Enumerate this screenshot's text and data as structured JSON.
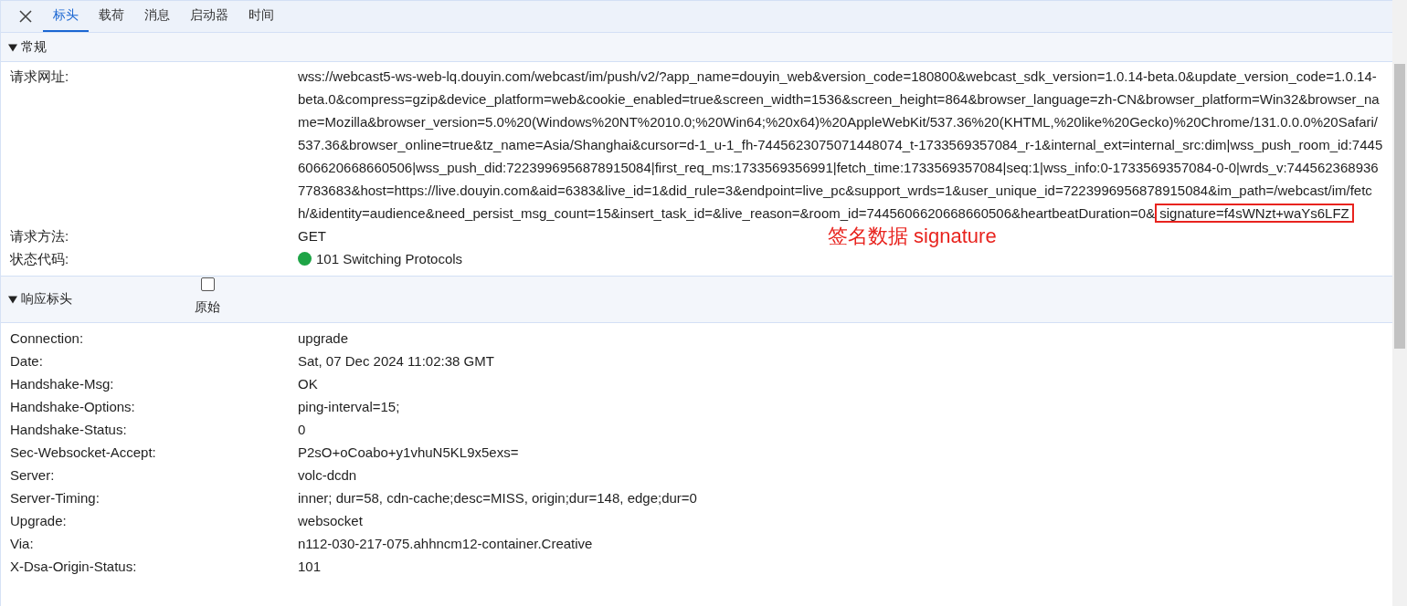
{
  "tabs": [
    {
      "label": "标头",
      "selected": true
    },
    {
      "label": "载荷",
      "selected": false
    },
    {
      "label": "消息",
      "selected": false
    },
    {
      "label": "启动器",
      "selected": false
    },
    {
      "label": "时间",
      "selected": false
    }
  ],
  "general": {
    "title": "常规",
    "expanded": true,
    "url_label": "请求网址:",
    "url": "wss://webcast5-ws-web-lq.douyin.com/webcast/im/push/v2/?app_name=douyin_web&version_code=180800&webcast_sdk_version=1.0.14-beta.0&update_version_code=1.0.14-beta.0&compress=gzip&device_platform=web&cookie_enabled=true&screen_width=1536&screen_height=864&browser_language=zh-CN&browser_platform=Win32&browser_name=Mozilla&browser_version=5.0%20(Windows%20NT%2010.0;%20Win64;%20x64)%20AppleWebKit/537.36%20(KHTML,%20like%20Gecko)%20Chrome/131.0.0.0%20Safari/537.36&browser_online=true&tz_name=Asia/Shanghai&cursor=d-1_u-1_fh-7445623075071448074_t-1733569357084_r-1&internal_ext=internal_src:dim|wss_push_room_id:7445606620668660506|wss_push_did:7223996956878915084|first_req_ms:1733569356991|fetch_time:1733569357084|seq:1|wss_info:0-1733569357084-0-0|wrds_v:7445623689367783683&host=https://live.douyin.com&aid=6383&live_id=1&did_rule=3&endpoint=live_pc&support_wrds=1&user_unique_id=7223996956878915084&im_path=/webcast/im/fetch/&identity=audience&need_persist_msg_count=15&insert_task_id=&live_reason=&room_id=7445606620668660506&heartbeatDuration=0&",
    "url_highlighted": "signature=f4sWNzt+waYs6LFZ",
    "annotation": "签名数据 signature",
    "method_label": "请求方法:",
    "method": "GET",
    "status_label": "状态代码:",
    "status": "101 Switching Protocols",
    "status_dot": {
      "color": "#1ea446"
    }
  },
  "response_headers": {
    "title": "响应标头",
    "expanded": true,
    "raw_label": "原始",
    "raw_checked": false,
    "rows": [
      {
        "name": "Connection:",
        "value": "upgrade"
      },
      {
        "name": "Date:",
        "value": "Sat, 07 Dec 2024 11:02:38 GMT"
      },
      {
        "name": "Handshake-Msg:",
        "value": "OK"
      },
      {
        "name": "Handshake-Options:",
        "value": "ping-interval=15;"
      },
      {
        "name": "Handshake-Status:",
        "value": "0"
      },
      {
        "name": "Sec-Websocket-Accept:",
        "value": "P2sO+oCoabo+y1vhuN5KL9x5exs="
      },
      {
        "name": "Server:",
        "value": "volc-dcdn"
      },
      {
        "name": "Server-Timing:",
        "value": "inner; dur=58, cdn-cache;desc=MISS, origin;dur=148, edge;dur=0"
      },
      {
        "name": "Upgrade:",
        "value": "websocket"
      },
      {
        "name": "Via:",
        "value": "n112-030-217-075.ahhncm12-container.Creative"
      },
      {
        "name": "X-Dsa-Origin-Status:",
        "value": "101"
      }
    ]
  }
}
